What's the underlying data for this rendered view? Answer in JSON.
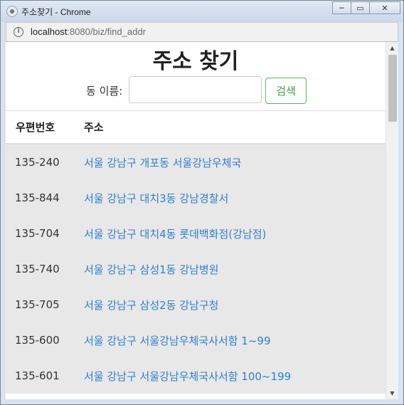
{
  "window": {
    "title": "주소찾기 - Chrome",
    "controls": {
      "minimize": "─",
      "maximize": "▭",
      "close": "✕"
    }
  },
  "addressbar": {
    "url_host": "localhost",
    "url_path": ":8080/biz/find_addr",
    "info_icon": "i"
  },
  "page": {
    "title": "주소 찾기",
    "search": {
      "label": "동 이름:",
      "value": "",
      "placeholder": "",
      "button_label": "검색",
      "button_color": "#5cb85c"
    },
    "table": {
      "headers": {
        "zip": "우편번호",
        "address": "주소"
      },
      "rows": [
        {
          "zip": "135-240",
          "address": "서울 강남구 개포동 서울강남우체국"
        },
        {
          "zip": "135-844",
          "address": "서울 강남구 대치3동 강남경찰서"
        },
        {
          "zip": "135-704",
          "address": "서울 강남구 대치4동 롯데백화점(강남점)"
        },
        {
          "zip": "135-740",
          "address": "서울 강남구 삼성1동 강남병원"
        },
        {
          "zip": "135-705",
          "address": "서울 강남구 삼성2동 강남구청"
        },
        {
          "zip": "135-600",
          "address": "서울 강남구 서울강남우체국사서함 1~99"
        },
        {
          "zip": "135-601",
          "address": "서울 강남구 서울강남우체국사서함 100~199"
        }
      ]
    }
  },
  "colors": {
    "link": "#2f7fcf",
    "row_bg": "#e8e8e8"
  }
}
